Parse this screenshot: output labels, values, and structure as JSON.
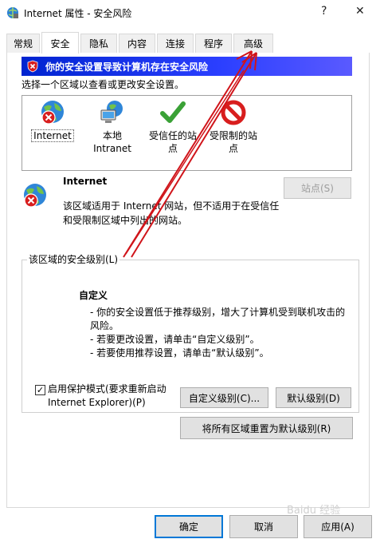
{
  "window": {
    "title": "Internet 属性 - 安全风险",
    "help_label": "?",
    "close_label": "✕"
  },
  "tabs": [
    {
      "label": "常规"
    },
    {
      "label": "安全"
    },
    {
      "label": "隐私"
    },
    {
      "label": "内容"
    },
    {
      "label": "连接"
    },
    {
      "label": "程序"
    },
    {
      "label": "高级"
    }
  ],
  "active_tab": "安全",
  "security": {
    "warning": "你的安全设置导致计算机存在安全风险",
    "choose_zone_text": "选择一个区域以查看或更改安全设置。",
    "zones": [
      {
        "label": "Internet",
        "icon": "globe-warning-icon"
      },
      {
        "label": "本地\nIntranet",
        "icon": "local-intranet-icon"
      },
      {
        "label": "受信任的站\n点",
        "icon": "check-icon"
      },
      {
        "label": "受限制的站\n点",
        "icon": "no-entry-icon"
      }
    ],
    "selected_zone": "Internet",
    "detail": {
      "title": "Internet",
      "description": "该区域适用于 Internet 网站，但不适用于在受信任和受限制区域中列出的网站。",
      "sites_button": "站点(S)"
    },
    "level_group": {
      "legend": "该区域的安全级别(L)",
      "title": "自定义",
      "lines": [
        "- 你的安全设置低于推荐级别，增大了计算机受到联机攻击的风险。",
        "- 若要更改设置，请单击“自定义级别”。",
        "- 若要使用推荐设置，请单击“默认级别”。"
      ],
      "protected_mode_label": "启用保护模式(要求重新启动 Internet Explorer)(P)",
      "protected_mode_checked": true,
      "custom_level_button": "自定义级别(C)...",
      "default_level_button": "默认级别(D)"
    },
    "reset_all_button": "将所有区域重置为默认级别(R)"
  },
  "footer": {
    "ok": "确定",
    "cancel": "取消",
    "apply": "应用(A)"
  },
  "watermark": "Baidu 经验",
  "colors": {
    "warning_bar": "#0024d0",
    "annotation_arrow": "#d0141a",
    "primary_border": "#0078d7"
  }
}
